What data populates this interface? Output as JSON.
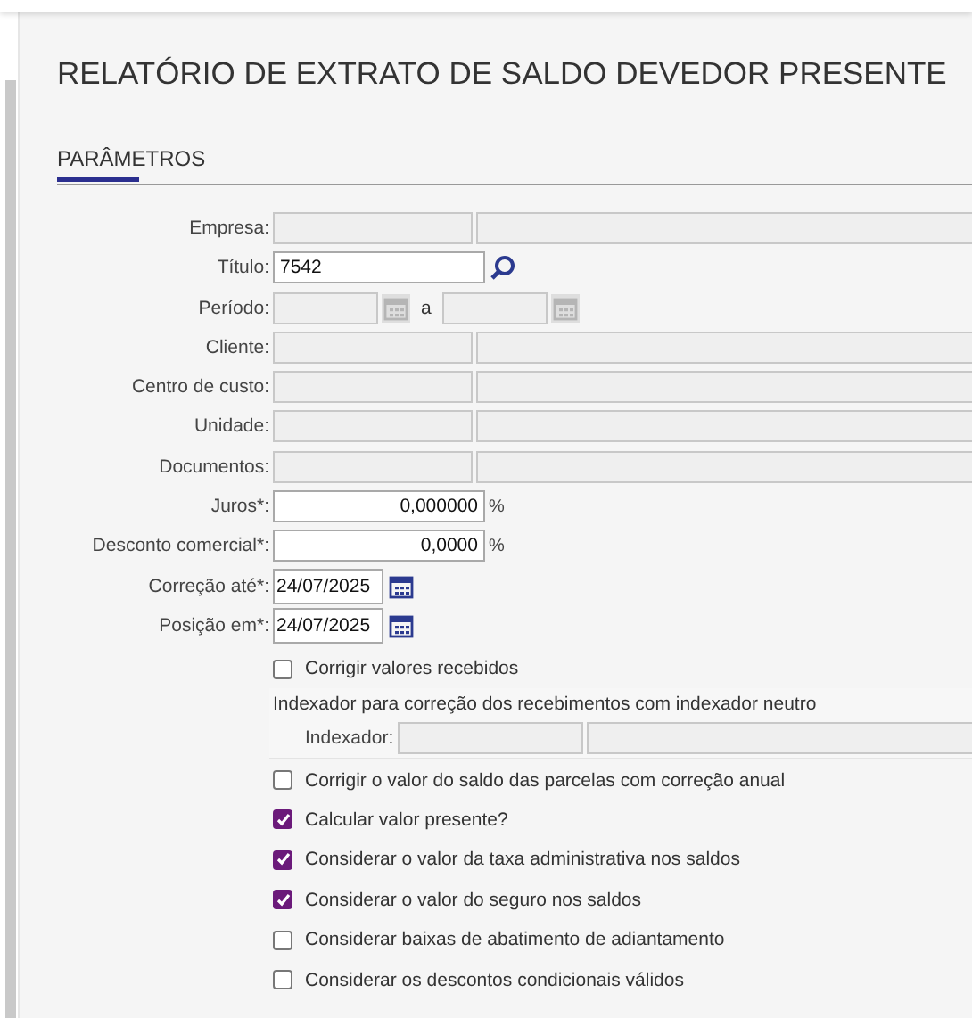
{
  "title": "RELATÓRIO DE EXTRATO DE SALDO DEVEDOR PRESENTE",
  "tabs": [
    {
      "label": "PARÂMETROS",
      "selected": true
    }
  ],
  "fields": [
    {
      "kind": "lookup",
      "label": "Empresa:",
      "disabled": true
    },
    {
      "kind": "text",
      "label": "Título:",
      "value": "7542",
      "disabled": false
    },
    {
      "kind": "range",
      "label": "Período:",
      "separator": "a",
      "disabled": true
    },
    {
      "kind": "lookup",
      "label": "Cliente:",
      "disabled": true
    },
    {
      "kind": "lookup",
      "label": "Centro de custo:",
      "disabled": true
    },
    {
      "kind": "lookup",
      "label": "Unidade:",
      "disabled": true
    },
    {
      "kind": "lookup",
      "label": "Documentos:",
      "disabled": true
    },
    {
      "kind": "number",
      "label": "Juros*:",
      "value": "0,000000",
      "unit": "%",
      "disabled": false
    },
    {
      "kind": "number",
      "label": "Desconto comercial*:",
      "value": "0,0000",
      "unit": "%",
      "disabled": false
    },
    {
      "kind": "date",
      "label": "Correção até*:",
      "value": "24/07/2025",
      "disabled": false
    },
    {
      "kind": "date",
      "label": "Posição em*:",
      "value": "24/07/2025",
      "disabled": false
    }
  ],
  "options": [
    {
      "kind": "checkbox",
      "label": "Corrigir valores recebidos",
      "checked": false
    },
    {
      "kind": "group",
      "note": "Indexador para correção dos recebimentos com indexador neutro",
      "label": "Indexador:",
      "disabled": true
    },
    {
      "kind": "checkbox",
      "label": "Corrigir o valor do saldo das parcelas com correção anual",
      "checked": false
    },
    {
      "kind": "checkbox",
      "label": "Calcular valor presente?",
      "checked": true
    },
    {
      "kind": "checkbox",
      "label": "Considerar o valor da taxa administrativa nos saldos",
      "checked": true
    },
    {
      "kind": "checkbox",
      "label": "Considerar o valor do seguro nos saldos",
      "checked": true
    },
    {
      "kind": "checkbox",
      "label": "Considerar baixas de abatimento de adiantamento",
      "checked": false
    },
    {
      "kind": "checkbox",
      "label": "Considerar os descontos condicionais válidos",
      "checked": false
    }
  ]
}
